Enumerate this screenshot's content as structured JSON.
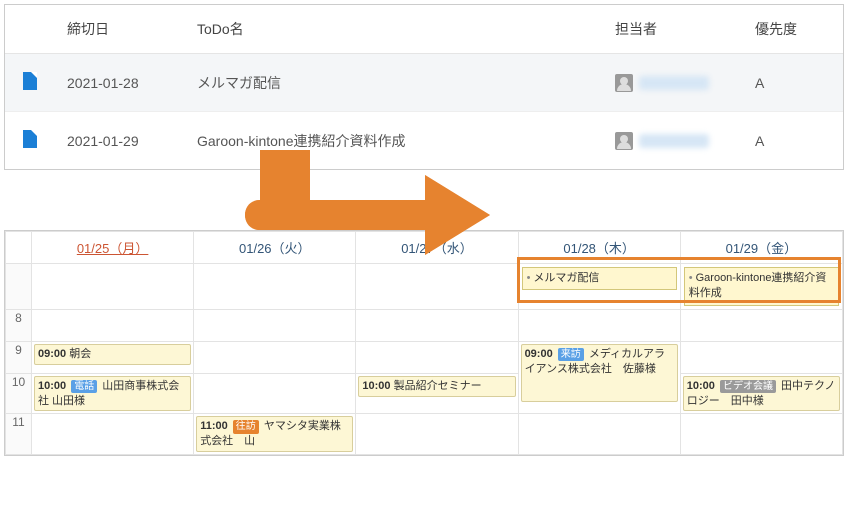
{
  "todo": {
    "headers": {
      "deadline": "締切日",
      "name": "ToDo名",
      "assignee": "担当者",
      "priority": "優先度"
    },
    "rows": [
      {
        "date": "2021-01-28",
        "title": "メルマガ配信",
        "priority": "A"
      },
      {
        "date": "2021-01-29",
        "title": "Garoon-kintone連携紹介資料作成",
        "priority": "A"
      }
    ]
  },
  "calendar": {
    "days": [
      {
        "label": "01/25（月）",
        "today": true
      },
      {
        "label": "01/26（火）",
        "today": false
      },
      {
        "label": "01/27（水）",
        "today": false
      },
      {
        "label": "01/28（木）",
        "today": false
      },
      {
        "label": "01/29（金）",
        "today": false
      }
    ],
    "hours": [
      "8",
      "9",
      "10",
      "11"
    ],
    "allday": {
      "thu": "メルマガ配信",
      "fri": "Garoon-kintone連携紹介資料作成"
    },
    "events": {
      "mon9": {
        "time": "09:00",
        "title": "朝会"
      },
      "mon10": {
        "time": "10:00",
        "tag": "電話",
        "title": "山田商事株式会社 山田様"
      },
      "tue11": {
        "time": "11:00",
        "tag": "往訪",
        "title": "ヤマシタ実業株式会社　山"
      },
      "wed10": {
        "time": "10:00",
        "title": "製品紹介セミナー"
      },
      "thu9": {
        "time": "09:00",
        "tag": "来訪",
        "title": "メディカルアライアンス株式会社　佐藤様"
      },
      "fri10": {
        "time": "10:00",
        "tag": "ビデオ会議",
        "title": "田中テクノロジー　田中様"
      }
    }
  }
}
